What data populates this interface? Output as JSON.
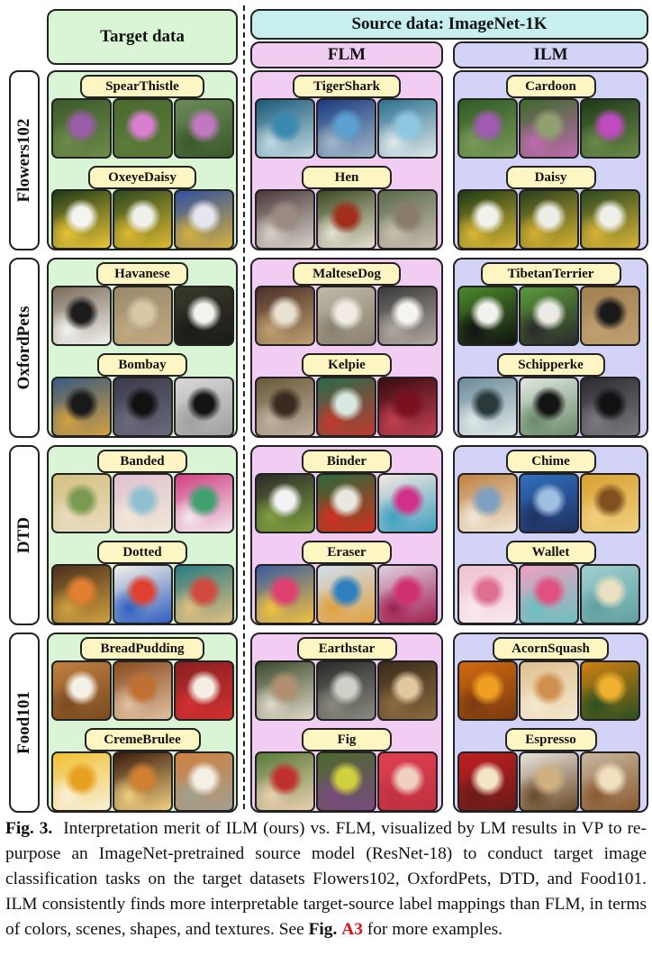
{
  "headers": {
    "target": "Target data",
    "source": "Source data: ImageNet-1K",
    "flm": "FLM",
    "ilm": "ILM"
  },
  "rows": [
    {
      "label": "Flowers102",
      "target": [
        "SpearThistle",
        "OxeyeDaisy"
      ],
      "flm": [
        "TigerShark",
        "Hen"
      ],
      "ilm": [
        "Cardoon",
        "Daisy"
      ]
    },
    {
      "label": "OxfordPets",
      "target": [
        "Havanese",
        "Bombay"
      ],
      "flm": [
        "MalteseDog",
        "Kelpie"
      ],
      "ilm": [
        "TibetanTerrier",
        "Schipperke"
      ]
    },
    {
      "label": "DTD",
      "target": [
        "Banded",
        "Dotted"
      ],
      "flm": [
        "Binder",
        "Eraser"
      ],
      "ilm": [
        "Chime",
        "Wallet"
      ]
    },
    {
      "label": "Food101",
      "target": [
        "BreadPudding",
        "CremeBrulee"
      ],
      "flm": [
        "Earthstar",
        "Fig"
      ],
      "ilm": [
        "AcornSquash",
        "Espresso"
      ]
    }
  ],
  "caption": {
    "prefix": "Fig. 3.",
    "body": "Interpretation merit of ILM (ours) vs. FLM, visualized by LM results in VP to re-purpose an ImageNet-pretrained source model (ResNet-18) to conduct target image classification tasks on the target datasets Flowers102, OxfordPets, DTD, and Food101. ILM consistently finds more interpretable target-source label mappings than FLM, in terms of colors, scenes, shapes, and textures. See",
    "ref_bold": "Fig.",
    "ref": "A3",
    "suffix": "for more examples."
  },
  "colors": {
    "target_bg": "#d9f5d5",
    "flm_bg": "#f2cdf3",
    "ilm_bg": "#d3d3f7",
    "source_bg": "#c6efee",
    "label_bg": "#fdf6c3",
    "ref_color": "#dd1111"
  },
  "thumb_palettes": {
    "Flowers102": {
      "target": [
        [
          "#3b5a2a",
          "#9a5ca8",
          "#6e8a4a"
        ],
        [
          "#4a6a2e",
          "#d97fcf",
          "#5c7a3a"
        ],
        [
          "#6b8a5a",
          "#c078c0",
          "#3a5a2a"
        ],
        [
          "#1f3a18",
          "#f4f4f0",
          "#e8c436"
        ],
        [
          "#2c4a20",
          "#f0f0ea",
          "#dcb830"
        ],
        [
          "#3050a0",
          "#e6e6f0",
          "#d4b040"
        ]
      ],
      "flm": [
        [
          "#1a5a7a",
          "#3a8ab0",
          "#c0d8e0"
        ],
        [
          "#1a3a80",
          "#5aa0d0",
          "#a0b8c8"
        ],
        [
          "#2a7090",
          "#8ec8e0",
          "#e0e8ea"
        ],
        [
          "#4a3a3a",
          "#9a8a80",
          "#d8d0c8"
        ],
        [
          "#3a4a20",
          "#a0301c",
          "#e6e0d0"
        ],
        [
          "#5a6a4a",
          "#8a7a6a",
          "#c8c0b0"
        ]
      ],
      "ilm": [
        [
          "#2e5a22",
          "#a05ab0",
          "#7a9a5a"
        ],
        [
          "#3c6a2a",
          "#90a070",
          "#c06ab0"
        ],
        [
          "#1e3a18",
          "#c04ac0",
          "#6a8a4a"
        ],
        [
          "#1e3a16",
          "#f2f2ec",
          "#dab836"
        ],
        [
          "#28401c",
          "#eeeee8",
          "#d4b032"
        ],
        [
          "#2a4820",
          "#f0f0ea",
          "#d8b438"
        ]
      ]
    },
    "OxfordPets": {
      "target": [
        [
          "#7a6a5a",
          "#1c1c1c",
          "#f2f2ee"
        ],
        [
          "#9a8a6a",
          "#d8c8a8",
          "#c0a880"
        ],
        [
          "#3a3a2a",
          "#f2f2ee",
          "#1a1a1a"
        ],
        [
          "#3a5a80",
          "#1a1a1a",
          "#d0a040"
        ],
        [
          "#3a3a4a",
          "#111111",
          "#6a6a7a"
        ],
        [
          "#d8d8d8",
          "#141414",
          "#a0a0a0"
        ]
      ],
      "flm": [
        [
          "#4a3028",
          "#e8e0d0",
          "#c0a070"
        ],
        [
          "#c0b8a8",
          "#f0ece4",
          "#8a8070"
        ],
        [
          "#3a3a3a",
          "#f4f4f0",
          "#b0a8a0"
        ],
        [
          "#6a5a3a",
          "#3a2a20",
          "#c0b0a0"
        ],
        [
          "#2a6a4a",
          "#d8e8e0",
          "#c03a30"
        ],
        [
          "#3a0a10",
          "#7a1020",
          "#c04050"
        ]
      ],
      "ilm": [
        [
          "#4a8a2a",
          "#f2f2ee",
          "#111111"
        ],
        [
          "#5a9a3a",
          "#eceae4",
          "#2a2a2a"
        ],
        [
          "#a08050",
          "#1a1a1a",
          "#c0a070"
        ],
        [
          "#6a8a9a",
          "#2a3a3a",
          "#e0e8e8"
        ],
        [
          "#e0e8e0",
          "#141414",
          "#6a8a6a"
        ],
        [
          "#2a2a30",
          "#111111",
          "#7a7a80"
        ]
      ]
    },
    "DTD": {
      "target": [
        [
          "#d4c080",
          "#7a9a50",
          "#e8dcc0"
        ],
        [
          "#e0c0d0",
          "#90c0d0",
          "#f0e8d8"
        ],
        [
          "#d04080",
          "#40a070",
          "#f4e8f0"
        ],
        [
          "#4a2e1a",
          "#e08030",
          "#d0a040"
        ],
        [
          "#f4f0e6",
          "#e04030",
          "#3060c0"
        ],
        [
          "#2a7a80",
          "#d04a40",
          "#e0c080"
        ]
      ],
      "flm": [
        [
          "#2a2a2a",
          "#f2f2f2",
          "#80a040"
        ],
        [
          "#2a6a3a",
          "#e8e8e0",
          "#d03020"
        ],
        [
          "#f4e8e0",
          "#d0308a",
          "#40a0c0"
        ],
        [
          "#3a5aa0",
          "#e04070",
          "#f0c040"
        ],
        [
          "#d0e0f0",
          "#3080c0",
          "#e0a040"
        ],
        [
          "#e0d0e0",
          "#d03070",
          "#a02050"
        ]
      ],
      "ilm": [
        [
          "#c08040",
          "#80a0c0",
          "#f0e8d8"
        ],
        [
          "#3070c0",
          "#a0c0e0",
          "#203060"
        ],
        [
          "#d8a030",
          "#805020",
          "#f0d080"
        ],
        [
          "#f0c0d0",
          "#e07090",
          "#f8e8f0"
        ],
        [
          "#f0a0c0",
          "#e05080",
          "#6ac0c0"
        ],
        [
          "#a0d0d0",
          "#e8e0c0",
          "#60a0a0"
        ]
      ]
    },
    "Food101": {
      "target": [
        [
          "#c08040",
          "#f4f0e6",
          "#7a4a20"
        ],
        [
          "#8a4a20",
          "#c07030",
          "#e0c0a0"
        ],
        [
          "#8a2020",
          "#f4eee4",
          "#d03030"
        ],
        [
          "#f0c030",
          "#e8a020",
          "#f8f0d8"
        ],
        [
          "#3a1a0a",
          "#d08030",
          "#f0d080"
        ],
        [
          "#d08040",
          "#f4f0e4",
          "#a0a090"
        ]
      ],
      "flm": [
        [
          "#3a4a2a",
          "#b09070",
          "#e0d8c8"
        ],
        [
          "#2a2a2a",
          "#d0d0c8",
          "#8a8a80"
        ],
        [
          "#3a2a1a",
          "#e0c8a0",
          "#8a6a40"
        ],
        [
          "#5a7a3a",
          "#c03030",
          "#e8d0b0"
        ],
        [
          "#4a6a2a",
          "#d0d040",
          "#7a4a80"
        ],
        [
          "#e04050",
          "#f0d0c0",
          "#c03040"
        ]
      ],
      "ilm": [
        [
          "#d06a10",
          "#f0a020",
          "#7a3a10"
        ],
        [
          "#e0c090",
          "#d09050",
          "#f4e8d0"
        ],
        [
          "#d08010",
          "#f0b030",
          "#2a5020"
        ],
        [
          "#c02020",
          "#f4e4c8",
          "#6a1a1a"
        ],
        [
          "#e8e4dc",
          "#d0b080",
          "#6a4a2a"
        ],
        [
          "#c8b8a0",
          "#f0e0c0",
          "#8a5a30"
        ]
      ]
    }
  }
}
